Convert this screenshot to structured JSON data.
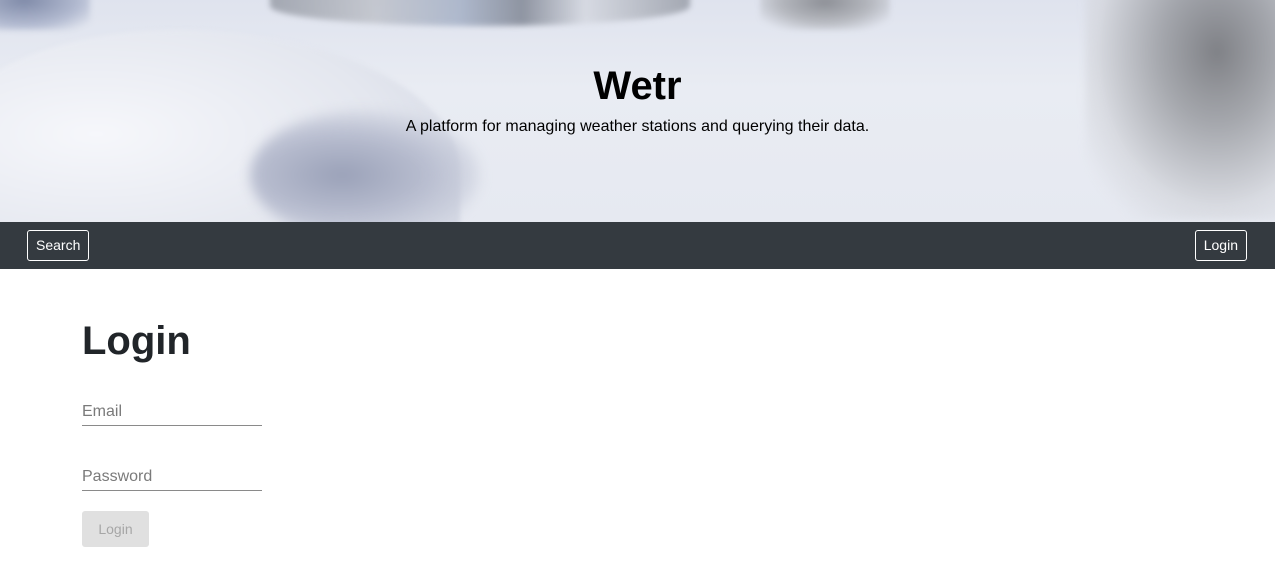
{
  "header": {
    "title": "Wetr",
    "subtitle": "A platform for managing weather stations and querying their data."
  },
  "navbar": {
    "search_label": "Search",
    "login_label": "Login"
  },
  "login_form": {
    "heading": "Login",
    "email_placeholder": "Email",
    "email_value": "",
    "password_placeholder": "Password",
    "password_value": "",
    "submit_label": "Login",
    "submit_disabled": true
  },
  "colors": {
    "navbar_bg": "#343a40",
    "heading_text": "#212529",
    "disabled_button_bg": "#e0e0e0"
  }
}
